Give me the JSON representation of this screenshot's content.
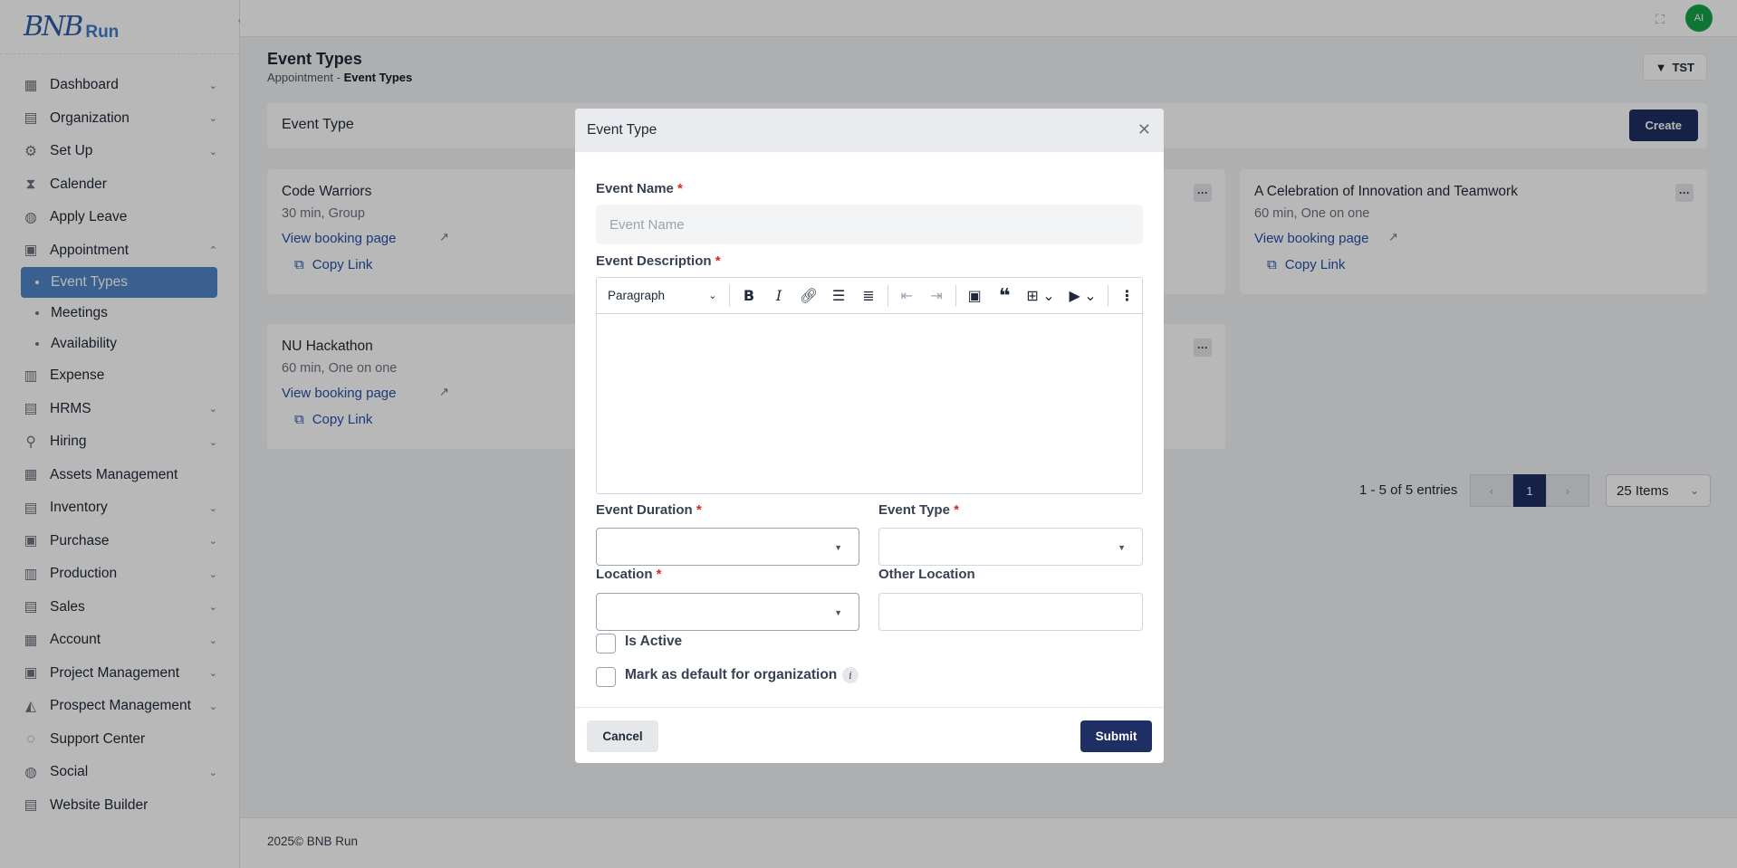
{
  "brand": {
    "logo": "BNB",
    "name": "Run"
  },
  "sidebar": {
    "items": [
      {
        "label": "Dashboard",
        "icon": "dashboard-icon",
        "chevron": "down"
      },
      {
        "label": "Organization",
        "icon": "organization-icon",
        "chevron": "down"
      },
      {
        "label": "Set Up",
        "icon": "setup-icon",
        "chevron": "down"
      },
      {
        "label": "Calender",
        "icon": "hourglass-icon",
        "chevron": ""
      },
      {
        "label": "Apply Leave",
        "icon": "leave-icon",
        "chevron": ""
      },
      {
        "label": "Appointment",
        "icon": "calendar-check-icon",
        "chevron": "up"
      }
    ],
    "subitems": [
      {
        "label": "Event Types",
        "active": true
      },
      {
        "label": "Meetings",
        "active": false
      },
      {
        "label": "Availability",
        "active": false
      }
    ],
    "items2": [
      {
        "label": "Expense",
        "icon": "expense-icon",
        "chevron": ""
      },
      {
        "label": "HRMS",
        "icon": "hrms-icon",
        "chevron": "down"
      },
      {
        "label": "Hiring",
        "icon": "hiring-icon",
        "chevron": "down"
      },
      {
        "label": "Assets Management",
        "icon": "assets-icon",
        "chevron": ""
      },
      {
        "label": "Inventory",
        "icon": "inventory-icon",
        "chevron": "down"
      },
      {
        "label": "Purchase",
        "icon": "purchase-icon",
        "chevron": "down"
      },
      {
        "label": "Production",
        "icon": "production-icon",
        "chevron": "down"
      },
      {
        "label": "Sales",
        "icon": "sales-icon",
        "chevron": "down"
      },
      {
        "label": "Account",
        "icon": "account-icon",
        "chevron": "down"
      },
      {
        "label": "Project Management",
        "icon": "project-icon",
        "chevron": "down"
      },
      {
        "label": "Prospect Management",
        "icon": "prospect-icon",
        "chevron": "down"
      },
      {
        "label": "Support Center",
        "icon": "support-icon",
        "chevron": ""
      },
      {
        "label": "Social",
        "icon": "social-icon",
        "chevron": "down"
      },
      {
        "label": "Website Builder",
        "icon": "website-icon",
        "chevron": ""
      }
    ]
  },
  "topbar": {
    "avatar": "AI"
  },
  "page": {
    "title": "Event Types",
    "breadcrumb_parent": "Appointment",
    "breadcrumb_sep": "-",
    "breadcrumb_current": "Event Types",
    "filter_label": "TST",
    "section_title": "Event Type",
    "create_label": "Create"
  },
  "cards": [
    {
      "title": "Code Warriors",
      "sub": "30 min, Group",
      "link": "View booking page",
      "copy": "Copy Link"
    },
    {
      "title": "A Celebration of Innovation and Teamwork",
      "sub": "60 min, One on one",
      "link": "View booking page",
      "copy": "Copy Link"
    },
    {
      "title": "NU Hackathon",
      "sub": "60 min, One on one",
      "link": "View booking page",
      "copy": "Copy Link"
    }
  ],
  "pagination": {
    "entries": "1 - 5 of 5 entries",
    "page": "1",
    "items": "25 Items"
  },
  "footer": {
    "text": "2025© BNB Run"
  },
  "modal": {
    "title": "Event Type",
    "event_name_label": "Event Name",
    "event_name_placeholder": "Event Name",
    "event_name_value": "",
    "description_label": "Event Description",
    "editor_block": "Paragraph",
    "duration_label": "Event Duration",
    "type_label": "Event Type",
    "location_label": "Location",
    "other_location_label": "Other Location",
    "is_active_label": "Is Active",
    "default_label": "Mark as default for organization",
    "required_mark": "*",
    "cancel_label": "Cancel",
    "submit_label": "Submit"
  },
  "colors": {
    "accent": "#1f2f63",
    "active_nav": "#4f86c6",
    "link": "#2451a8",
    "required": "#dc2626"
  }
}
